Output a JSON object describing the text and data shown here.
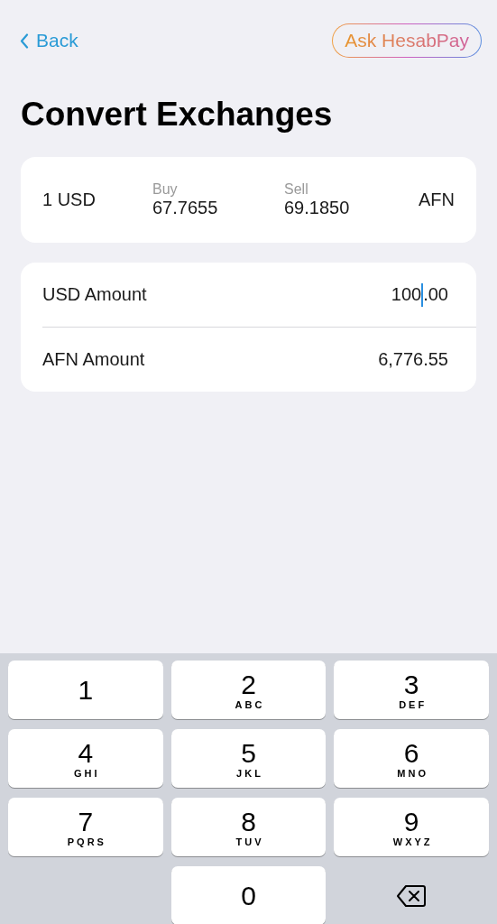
{
  "nav": {
    "back": "Back",
    "assistant": "Ask HesabPay"
  },
  "title": "Convert Exchanges",
  "rate": {
    "base": "1 USD",
    "buy_label": "Buy",
    "buy": "67.7655",
    "sell_label": "Sell",
    "sell": "69.1850",
    "quote": "AFN"
  },
  "amounts": [
    {
      "label": "USD Amount",
      "focused": true,
      "value_before_caret": "100",
      "value_after_caret": ".00"
    },
    {
      "label": "AFN Amount",
      "focused": false,
      "value_before_caret": "6,776.55"
    }
  ],
  "keypad": [
    {
      "kind": "digit",
      "digit": "1"
    },
    {
      "kind": "digit",
      "digit": "2",
      "letters": "ABC"
    },
    {
      "kind": "digit",
      "digit": "3",
      "letters": "DEF"
    },
    {
      "kind": "digit",
      "digit": "4",
      "letters": "GHI"
    },
    {
      "kind": "digit",
      "digit": "5",
      "letters": "JKL"
    },
    {
      "kind": "digit",
      "digit": "6",
      "letters": "MNO"
    },
    {
      "kind": "digit",
      "digit": "7",
      "letters": "PQRS"
    },
    {
      "kind": "digit",
      "digit": "8",
      "letters": "TUV"
    },
    {
      "kind": "digit",
      "digit": "9",
      "letters": "WXYZ"
    },
    {
      "kind": "empty"
    },
    {
      "kind": "digit",
      "digit": "0"
    },
    {
      "kind": "delete"
    }
  ]
}
